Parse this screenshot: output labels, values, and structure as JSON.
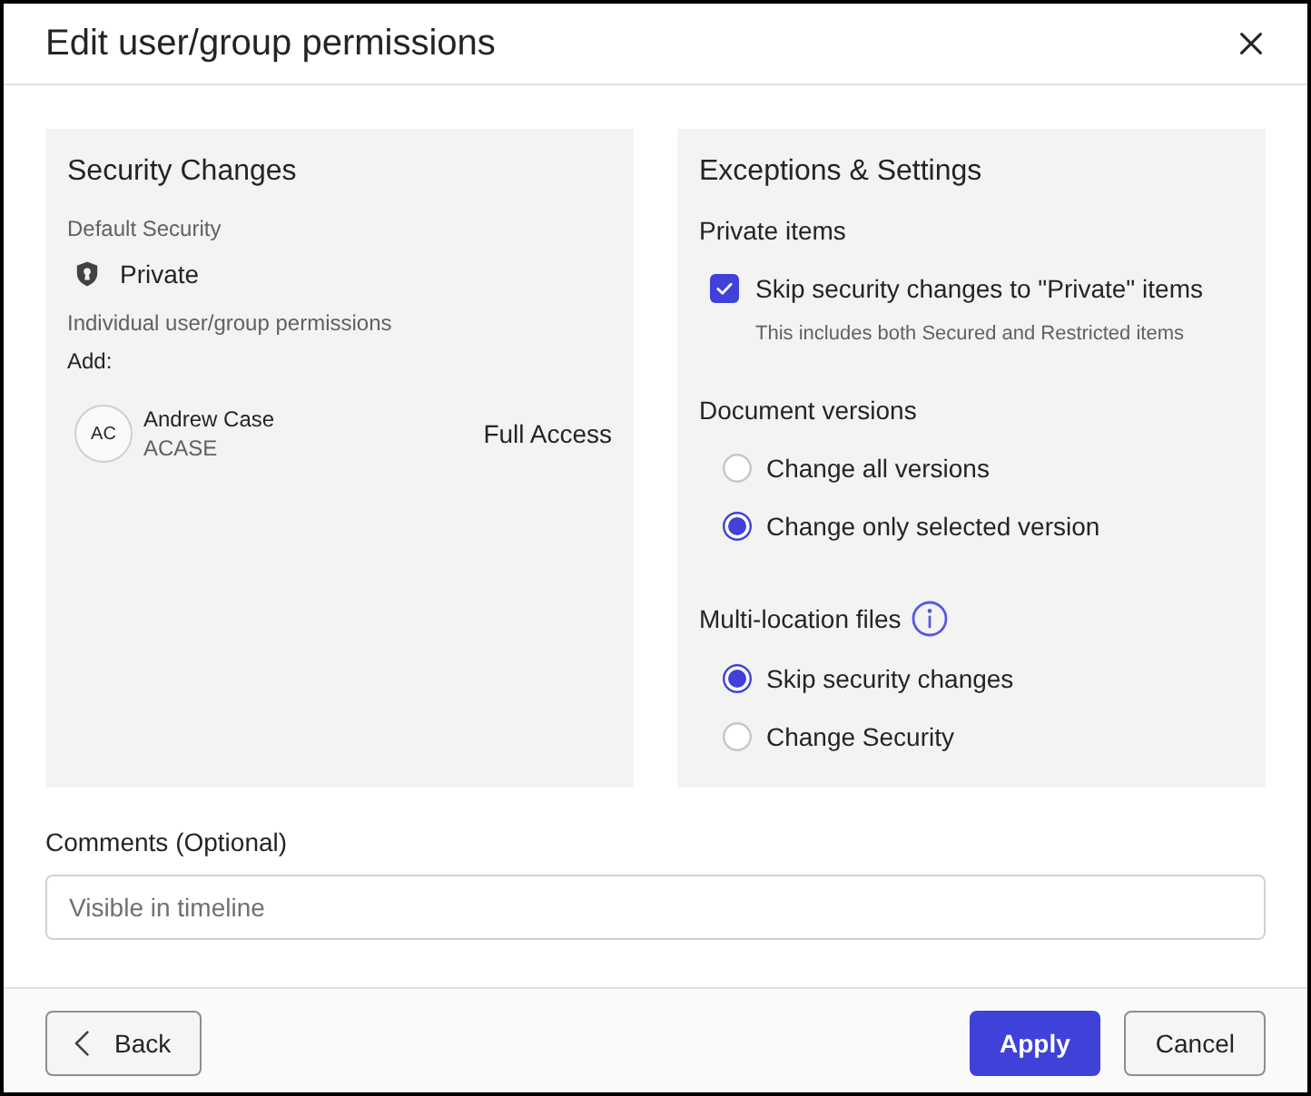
{
  "window": {
    "title": "Edit user/group permissions"
  },
  "security_changes": {
    "title": "Security Changes",
    "default_security": {
      "label": "Default Security",
      "value": "Private"
    },
    "permissions": {
      "label": "Individual user/group permissions",
      "add_label": "Add:",
      "entries": [
        {
          "initials": "AC",
          "name": "Andrew Case",
          "username": "ACASE",
          "access": "Full Access"
        }
      ]
    }
  },
  "exceptions": {
    "title": "Exceptions & Settings",
    "groups": [
      {
        "heading": "Private items",
        "info": false,
        "options": [
          {
            "kind": "checkbox",
            "label": "Skip security changes to \"Private\" items",
            "hint": "This includes both Secured and Restricted items",
            "checked": true
          }
        ]
      },
      {
        "heading": "Document versions",
        "info": false,
        "options": [
          {
            "kind": "radio",
            "label": "Change all versions",
            "selected": false
          },
          {
            "kind": "radio",
            "label": "Change only selected version",
            "selected": true
          }
        ]
      },
      {
        "heading": "Multi-location files",
        "info": true,
        "options": [
          {
            "kind": "radio",
            "label": "Skip security changes",
            "selected": true
          },
          {
            "kind": "radio",
            "label": "Change Security",
            "selected": false
          }
        ]
      }
    ]
  },
  "comments": {
    "label": "Comments (Optional)",
    "placeholder": "Visible in timeline"
  },
  "footer": {
    "buttons": [
      {
        "kind": "back",
        "label": "Back"
      },
      {
        "kind": "primary",
        "label": "Apply"
      },
      {
        "kind": "secondary",
        "label": "Cancel"
      }
    ]
  }
}
